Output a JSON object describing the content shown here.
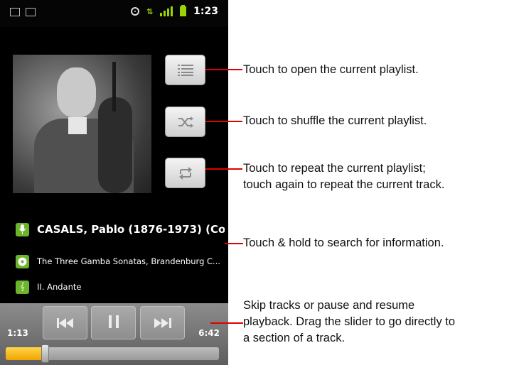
{
  "status_bar": {
    "time": "1:23"
  },
  "side_buttons": [
    {
      "name": "playlist",
      "icon": "playlist-icon"
    },
    {
      "name": "shuffle",
      "icon": "shuffle-icon"
    },
    {
      "name": "repeat",
      "icon": "repeat-icon"
    }
  ],
  "track_info": {
    "artist": "CASALS, Pablo (1876-1973) (Co...",
    "album": "The Three Gamba Sonatas, Brandenburg C...",
    "title": "II. Andante"
  },
  "controls": {
    "elapsed": "1:13",
    "duration": "6:42",
    "progress_fraction": 0.18
  },
  "callouts": {
    "playlist": "Touch to open the current playlist.",
    "shuffle": "Touch to shuffle the current playlist.",
    "repeat_line1": "Touch to repeat the current playlist;",
    "repeat_line2": "touch again to repeat the current track.",
    "search": "Touch & hold to search for information.",
    "skip_line1": "Skip tracks or pause and resume",
    "skip_line2": "playback. Drag the slider to go directly to",
    "skip_line3": "a section of a track."
  },
  "colors": {
    "accent_green": "#6bb52b",
    "callout_line": "#e00000",
    "progress_fill": "#f0a500"
  }
}
